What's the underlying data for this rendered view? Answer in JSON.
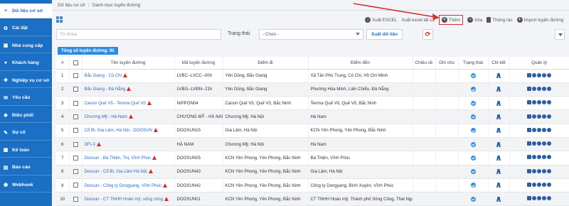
{
  "sidebar": {
    "items": [
      {
        "label": "Dữ liệu cơ sở",
        "icon": "database-icon",
        "active": true
      },
      {
        "label": "Cài đặt",
        "icon": "gear-icon",
        "active": false
      },
      {
        "label": "Nhà cung cấp",
        "icon": "truck-icon",
        "active": false
      },
      {
        "label": "Khách hàng",
        "icon": "users-icon",
        "active": false
      },
      {
        "label": "Nghiệp vụ cơ sở",
        "icon": "briefcase-icon",
        "active": false
      },
      {
        "label": "Yêu cầu",
        "icon": "envelope-icon",
        "active": false
      },
      {
        "label": "Điều phối",
        "icon": "car-icon",
        "active": false
      },
      {
        "label": "Sự cố",
        "icon": "tools-icon",
        "active": false
      },
      {
        "label": "Kế toán",
        "icon": "calculator-icon",
        "active": false
      },
      {
        "label": "Báo cáo",
        "icon": "report-icon",
        "active": false
      },
      {
        "label": "Webhook",
        "icon": "webhook-icon",
        "active": false
      }
    ]
  },
  "breadcrumb": {
    "parent": "Dữ liệu cơ sở",
    "separator": "/",
    "current": "Danh mục tuyến đường"
  },
  "toolbar": {
    "export_excel": "Xuất EXCEL",
    "export_excel_all": "Xuất excel tất cả",
    "add": "Thêm",
    "delete": "Xóa",
    "trash": "Thùng rác",
    "import": "Import tuyến đường"
  },
  "filters": {
    "keyword_placeholder": "Từ khóa",
    "status_label": "Trạng thái",
    "status_value": "- Chọn -",
    "export_button": "Xuất dữ liệu"
  },
  "total_label": "Tổng số tuyến đường: 92",
  "table": {
    "headers": [
      "#",
      "",
      "Tên tuyến đường",
      "Mã tuyến đường",
      "Điểm đi",
      "Điểm đến",
      "Chiều về",
      "Ghi chú",
      "Trạng thái",
      "Chi tiết",
      "Quản lý"
    ],
    "rows": [
      {
        "no": "1",
        "name": "Bắc Giang - Củ Chi",
        "warn": true,
        "code": "LVBC--LVCC--00h",
        "from": "Yên Dũng, Bắc Giang",
        "to": "Xã Tân Phú Trung, Củ Chi, Hồ Chí Minh"
      },
      {
        "no": "2",
        "name": "Bắc Giang - Đà Nẵng",
        "warn": true,
        "code": "LVBG--LVĐN--21h",
        "from": "Yên Dũng, Bắc Giang",
        "to": "Phường Hòa Minh, Liên Chiểu, Đà Nẵng"
      },
      {
        "no": "3",
        "name": "Canon Quế Võ - Tenma Quế Võ",
        "warn": true,
        "code": "NIPPON04",
        "from": "Canon Quế Võ, Quế Võ, Bắc Ninh",
        "to": "Tenma Quế Võ, Quế Võ, Bắc Ninh"
      },
      {
        "no": "4",
        "name": "Chương Mỹ - Hà Nam",
        "warn": true,
        "code": "CHƯƠNG MỸ - HÀ NAM",
        "from": "Chương Mỹ, Hà Nội",
        "to": "Hà Nam"
      },
      {
        "no": "5",
        "name": "Cổ Bi, Gia Lâm, Hà Nội - DOOSUN",
        "warn": true,
        "code": "DOOSUN15",
        "from": "Gia Lâm, Hà Nội",
        "to": "KCN Yên Phong, Yên Phong, Bắc Ninh"
      },
      {
        "no": "6",
        "name": "DFI-3",
        "warn": true,
        "code": "HÀ NAM",
        "from": "Chương Mỹ, Hà Nội",
        "to": "Hà Nam"
      },
      {
        "no": "7",
        "name": "Doosun - Bá Thiện, Thị, Vĩnh Phúc",
        "warn": true,
        "code": "DOOSUN05",
        "from": "KCN Yên Phong, Yên Phong, Bắc Ninh",
        "to": "Bá Thiện, Vĩnh Phúc"
      },
      {
        "no": "8",
        "name": "Doosun - Cổ Bi, Gia Lâm Hà Nội",
        "warn": true,
        "code": "DOOSUN43",
        "from": "KCN Yên Phong, Yên Phong, Bắc Ninh",
        "to": "Gia Lâm, Hà Nội"
      },
      {
        "no": "9",
        "name": "Doosun - Công ty Dongyang, Vĩnh Phúc",
        "warn": true,
        "code": "DOOSUN42",
        "from": "KCN Yên Phong, Yên Phong, Bắc Ninh",
        "to": "Công ty Dongyang, Bình Xuyên, Vĩnh Phúc"
      },
      {
        "no": "10",
        "name": "Doosun - CT TNHH Hoàn mỹ, sông công",
        "warn": true,
        "code": "DOOSUN01",
        "from": "KCN Yên Phong, Yên Phong, Bắc Ninh",
        "to": "CT TNHH Hoàn mỹ, Thành phố Sông Công, Thái Nguyên"
      }
    ]
  },
  "colors": {
    "sidebar": "#1a6fc2",
    "link": "#2a6ebf",
    "warning": "#d32f2f",
    "annotation": "#d32f2f",
    "badge": "#2e8be0"
  }
}
